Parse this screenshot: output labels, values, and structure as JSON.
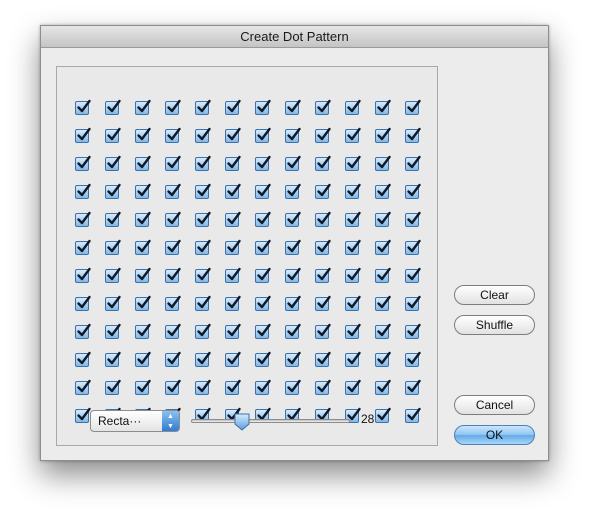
{
  "window": {
    "title": "Create Dot Pattern"
  },
  "grid": {
    "rows": 12,
    "cols": 12,
    "checked": [
      [
        true,
        true,
        true,
        true,
        true,
        true,
        true,
        true,
        true,
        true,
        true,
        true
      ],
      [
        true,
        true,
        true,
        true,
        true,
        true,
        true,
        true,
        true,
        true,
        true,
        true
      ],
      [
        true,
        true,
        true,
        true,
        true,
        true,
        true,
        true,
        true,
        true,
        true,
        true
      ],
      [
        true,
        true,
        true,
        true,
        true,
        true,
        true,
        true,
        true,
        true,
        true,
        true
      ],
      [
        true,
        true,
        true,
        true,
        true,
        true,
        true,
        true,
        true,
        true,
        true,
        true
      ],
      [
        true,
        true,
        true,
        true,
        true,
        true,
        true,
        true,
        true,
        true,
        true,
        true
      ],
      [
        true,
        true,
        true,
        true,
        true,
        true,
        true,
        true,
        true,
        true,
        true,
        true
      ],
      [
        true,
        true,
        true,
        true,
        true,
        true,
        true,
        true,
        true,
        true,
        true,
        true
      ],
      [
        true,
        true,
        true,
        true,
        true,
        true,
        true,
        true,
        true,
        true,
        true,
        true
      ],
      [
        true,
        true,
        true,
        true,
        true,
        true,
        true,
        true,
        true,
        true,
        true,
        true
      ],
      [
        true,
        true,
        true,
        true,
        true,
        true,
        true,
        true,
        true,
        true,
        true,
        true
      ],
      [
        true,
        true,
        true,
        true,
        true,
        true,
        true,
        true,
        true,
        true,
        true,
        true
      ]
    ]
  },
  "shape_popup": {
    "selected": "Recta···"
  },
  "size_slider": {
    "value": "28",
    "min": 0,
    "max": 100,
    "fraction": 0.3
  },
  "buttons": {
    "clear": "Clear",
    "shuffle": "Shuffle",
    "cancel": "Cancel",
    "ok": "OK"
  },
  "icons": {
    "checkbox": "checkmark-icon",
    "popup_arrows": "up-down-arrows-icon",
    "slider_thumb": "slider-thumb-icon"
  },
  "colors": {
    "accent": "#5aa2e6",
    "checkbox_border": "#3d6fa8",
    "window_bg": "#ececec"
  }
}
